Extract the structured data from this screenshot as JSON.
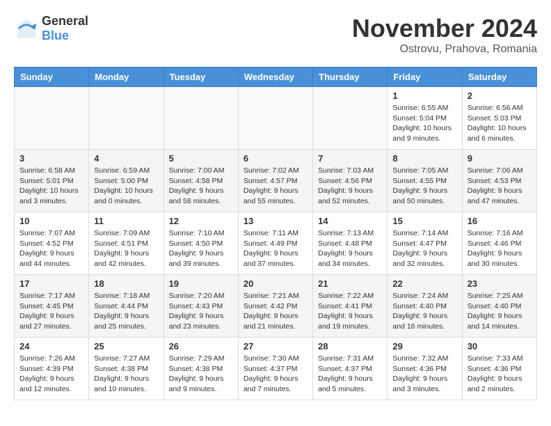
{
  "header": {
    "logo_general": "General",
    "logo_blue": "Blue",
    "month_title": "November 2024",
    "location": "Ostrovu, Prahova, Romania"
  },
  "days_of_week": [
    "Sunday",
    "Monday",
    "Tuesday",
    "Wednesday",
    "Thursday",
    "Friday",
    "Saturday"
  ],
  "weeks": [
    [
      {
        "day": "",
        "info": ""
      },
      {
        "day": "",
        "info": ""
      },
      {
        "day": "",
        "info": ""
      },
      {
        "day": "",
        "info": ""
      },
      {
        "day": "",
        "info": ""
      },
      {
        "day": "1",
        "info": "Sunrise: 6:55 AM\nSunset: 5:04 PM\nDaylight: 10 hours and 9 minutes."
      },
      {
        "day": "2",
        "info": "Sunrise: 6:56 AM\nSunset: 5:03 PM\nDaylight: 10 hours and 6 minutes."
      }
    ],
    [
      {
        "day": "3",
        "info": "Sunrise: 6:58 AM\nSunset: 5:01 PM\nDaylight: 10 hours and 3 minutes."
      },
      {
        "day": "4",
        "info": "Sunrise: 6:59 AM\nSunset: 5:00 PM\nDaylight: 10 hours and 0 minutes."
      },
      {
        "day": "5",
        "info": "Sunrise: 7:00 AM\nSunset: 4:58 PM\nDaylight: 9 hours and 58 minutes."
      },
      {
        "day": "6",
        "info": "Sunrise: 7:02 AM\nSunset: 4:57 PM\nDaylight: 9 hours and 55 minutes."
      },
      {
        "day": "7",
        "info": "Sunrise: 7:03 AM\nSunset: 4:56 PM\nDaylight: 9 hours and 52 minutes."
      },
      {
        "day": "8",
        "info": "Sunrise: 7:05 AM\nSunset: 4:55 PM\nDaylight: 9 hours and 50 minutes."
      },
      {
        "day": "9",
        "info": "Sunrise: 7:06 AM\nSunset: 4:53 PM\nDaylight: 9 hours and 47 minutes."
      }
    ],
    [
      {
        "day": "10",
        "info": "Sunrise: 7:07 AM\nSunset: 4:52 PM\nDaylight: 9 hours and 44 minutes."
      },
      {
        "day": "11",
        "info": "Sunrise: 7:09 AM\nSunset: 4:51 PM\nDaylight: 9 hours and 42 minutes."
      },
      {
        "day": "12",
        "info": "Sunrise: 7:10 AM\nSunset: 4:50 PM\nDaylight: 9 hours and 39 minutes."
      },
      {
        "day": "13",
        "info": "Sunrise: 7:11 AM\nSunset: 4:49 PM\nDaylight: 9 hours and 37 minutes."
      },
      {
        "day": "14",
        "info": "Sunrise: 7:13 AM\nSunset: 4:48 PM\nDaylight: 9 hours and 34 minutes."
      },
      {
        "day": "15",
        "info": "Sunrise: 7:14 AM\nSunset: 4:47 PM\nDaylight: 9 hours and 32 minutes."
      },
      {
        "day": "16",
        "info": "Sunrise: 7:16 AM\nSunset: 4:46 PM\nDaylight: 9 hours and 30 minutes."
      }
    ],
    [
      {
        "day": "17",
        "info": "Sunrise: 7:17 AM\nSunset: 4:45 PM\nDaylight: 9 hours and 27 minutes."
      },
      {
        "day": "18",
        "info": "Sunrise: 7:18 AM\nSunset: 4:44 PM\nDaylight: 9 hours and 25 minutes."
      },
      {
        "day": "19",
        "info": "Sunrise: 7:20 AM\nSunset: 4:43 PM\nDaylight: 9 hours and 23 minutes."
      },
      {
        "day": "20",
        "info": "Sunrise: 7:21 AM\nSunset: 4:42 PM\nDaylight: 9 hours and 21 minutes."
      },
      {
        "day": "21",
        "info": "Sunrise: 7:22 AM\nSunset: 4:41 PM\nDaylight: 9 hours and 19 minutes."
      },
      {
        "day": "22",
        "info": "Sunrise: 7:24 AM\nSunset: 4:40 PM\nDaylight: 9 hours and 16 minutes."
      },
      {
        "day": "23",
        "info": "Sunrise: 7:25 AM\nSunset: 4:40 PM\nDaylight: 9 hours and 14 minutes."
      }
    ],
    [
      {
        "day": "24",
        "info": "Sunrise: 7:26 AM\nSunset: 4:39 PM\nDaylight: 9 hours and 12 minutes."
      },
      {
        "day": "25",
        "info": "Sunrise: 7:27 AM\nSunset: 4:38 PM\nDaylight: 9 hours and 10 minutes."
      },
      {
        "day": "26",
        "info": "Sunrise: 7:29 AM\nSunset: 4:38 PM\nDaylight: 9 hours and 9 minutes."
      },
      {
        "day": "27",
        "info": "Sunrise: 7:30 AM\nSunset: 4:37 PM\nDaylight: 9 hours and 7 minutes."
      },
      {
        "day": "28",
        "info": "Sunrise: 7:31 AM\nSunset: 4:37 PM\nDaylight: 9 hours and 5 minutes."
      },
      {
        "day": "29",
        "info": "Sunrise: 7:32 AM\nSunset: 4:36 PM\nDaylight: 9 hours and 3 minutes."
      },
      {
        "day": "30",
        "info": "Sunrise: 7:33 AM\nSunset: 4:36 PM\nDaylight: 9 hours and 2 minutes."
      }
    ]
  ]
}
